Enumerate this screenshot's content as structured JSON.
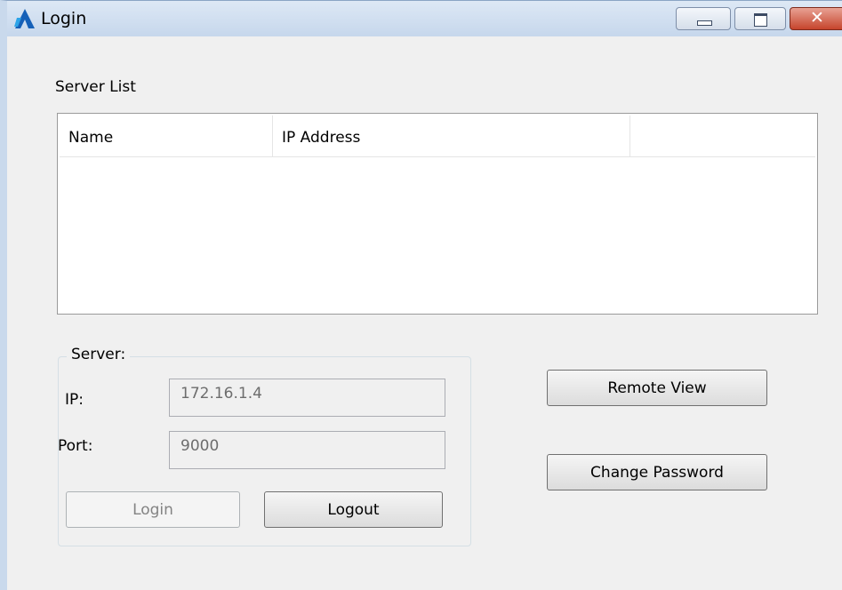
{
  "window": {
    "title": "Login",
    "controls": {
      "minimize": "minimize-icon",
      "maximize": "maximize-icon",
      "close": "close-icon"
    }
  },
  "server_list": {
    "label": "Server List",
    "columns": [
      "Name",
      "IP Address",
      ""
    ],
    "rows": []
  },
  "server_group": {
    "title": "Server:",
    "ip_label": "IP:",
    "ip_value": "172.16.1.4",
    "port_label": "Port:",
    "port_value": "9000",
    "login_label": "Login",
    "logout_label": "Logout"
  },
  "actions": {
    "remote_view_label": "Remote View",
    "change_password_label": "Change Password"
  },
  "colors": {
    "titlebar": "#c6d7ec",
    "close_button": "#c6442c",
    "dialog_bg": "#f0f0f0"
  }
}
